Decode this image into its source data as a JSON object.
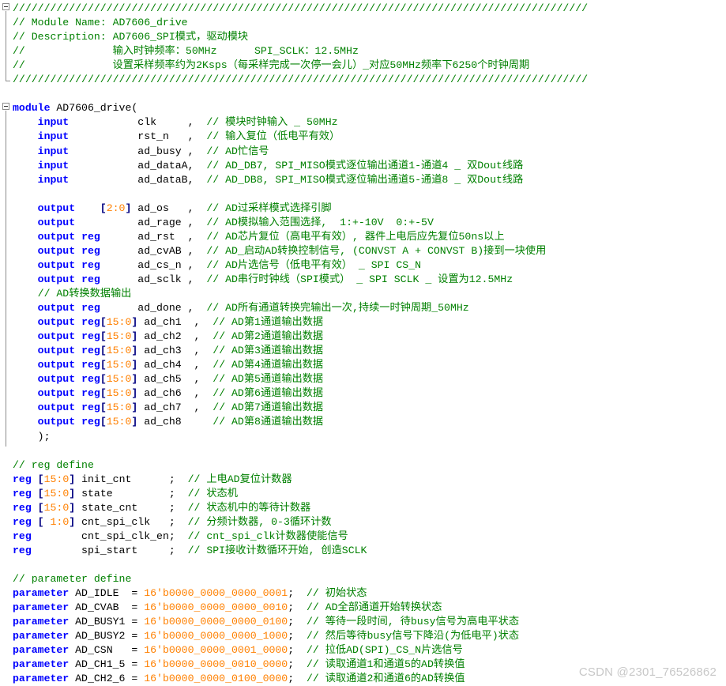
{
  "editor": {
    "language": "verilog",
    "colors": {
      "comment": "#008000",
      "keyword": "#0000ff",
      "number": "#ff8000",
      "operator": "#000080",
      "text": "#000000"
    },
    "lines": [
      [
        [
          "cm",
          "////////////////////////////////////////////////////////////////////////////////////////////"
        ]
      ],
      [
        [
          "cm",
          "// Module Name: AD7606_drive"
        ]
      ],
      [
        [
          "cm",
          "// Description: AD7606_SPI模式，驱动模块"
        ]
      ],
      [
        [
          "cm",
          "//              输入时钟频率：50MHz      SPI_SCLK：12.5MHz"
        ]
      ],
      [
        [
          "cm",
          "//              设置采样频率约为2Ksps（每采样完成一次停一会儿）_对应50MHz频率下6250个时钟周期"
        ]
      ],
      [
        [
          "cm",
          "////////////////////////////////////////////////////////////////////////////////////////////"
        ]
      ],
      [],
      [
        [
          "kw",
          "module"
        ],
        [
          "id",
          " AD7606_drive("
        ]
      ],
      [
        [
          "id",
          "    "
        ],
        [
          "kw",
          "input"
        ],
        [
          "id",
          "           clk     ,  "
        ],
        [
          "cm",
          "// 模块时钟输入 _ 50MHz"
        ]
      ],
      [
        [
          "id",
          "    "
        ],
        [
          "kw",
          "input"
        ],
        [
          "id",
          "           rst_n   ,  "
        ],
        [
          "cm",
          "// 输入复位（低电平有效）"
        ]
      ],
      [
        [
          "id",
          "    "
        ],
        [
          "kw",
          "input"
        ],
        [
          "id",
          "           ad_busy ,  "
        ],
        [
          "cm",
          "// AD忙信号"
        ]
      ],
      [
        [
          "id",
          "    "
        ],
        [
          "kw",
          "input"
        ],
        [
          "id",
          "           ad_dataA,  "
        ],
        [
          "cm",
          "// AD_DB7, SPI_MISO模式逐位输出通道1-通道4 _ 双Dout线路"
        ]
      ],
      [
        [
          "id",
          "    "
        ],
        [
          "kw",
          "input"
        ],
        [
          "id",
          "           ad_dataB,  "
        ],
        [
          "cm",
          "// AD_DB8, SPI_MISO模式逐位输出通道5-通道8 _ 双Dout线路"
        ]
      ],
      [],
      [
        [
          "id",
          "    "
        ],
        [
          "kw",
          "output"
        ],
        [
          "id",
          "    "
        ],
        [
          "op",
          "["
        ],
        [
          "nm",
          "2:0"
        ],
        [
          "op",
          "]"
        ],
        [
          "id",
          " ad_os   ,  "
        ],
        [
          "cm",
          "// AD过采样模式选择引脚"
        ]
      ],
      [
        [
          "id",
          "    "
        ],
        [
          "kw",
          "output"
        ],
        [
          "id",
          "          ad_rage ,  "
        ],
        [
          "cm",
          "// AD模拟输入范围选择,  1:+-10V  0:+-5V"
        ]
      ],
      [
        [
          "id",
          "    "
        ],
        [
          "kw",
          "output"
        ],
        [
          "id",
          " "
        ],
        [
          "kw",
          "reg"
        ],
        [
          "id",
          "      ad_rst  ,  "
        ],
        [
          "cm",
          "// AD芯片复位（高电平有效）, 器件上电后应先复位50ns以上"
        ]
      ],
      [
        [
          "id",
          "    "
        ],
        [
          "kw",
          "output"
        ],
        [
          "id",
          " "
        ],
        [
          "kw",
          "reg"
        ],
        [
          "id",
          "      ad_cvAB ,  "
        ],
        [
          "cm",
          "// AD_启动AD转换控制信号, (CONVST A + CONVST B)接到一块使用"
        ]
      ],
      [
        [
          "id",
          "    "
        ],
        [
          "kw",
          "output"
        ],
        [
          "id",
          " "
        ],
        [
          "kw",
          "reg"
        ],
        [
          "id",
          "      ad_cs_n ,  "
        ],
        [
          "cm",
          "// AD片选信号（低电平有效） _ SPI CS_N"
        ]
      ],
      [
        [
          "id",
          "    "
        ],
        [
          "kw",
          "output"
        ],
        [
          "id",
          " "
        ],
        [
          "kw",
          "reg"
        ],
        [
          "id",
          "      ad_sclk ,  "
        ],
        [
          "cm",
          "// AD串行时钟线（SPI模式） _ SPI SCLK _ 设置为12.5MHz"
        ]
      ],
      [
        [
          "id",
          "    "
        ],
        [
          "cm",
          "// AD转换数据输出"
        ]
      ],
      [
        [
          "id",
          "    "
        ],
        [
          "kw",
          "output"
        ],
        [
          "id",
          " "
        ],
        [
          "kw",
          "reg"
        ],
        [
          "id",
          "      ad_done ,  "
        ],
        [
          "cm",
          "// AD所有通道转换完输出一次,持续一时钟周期_50MHz"
        ]
      ],
      [
        [
          "id",
          "    "
        ],
        [
          "kw",
          "output"
        ],
        [
          "id",
          " "
        ],
        [
          "kw",
          "reg"
        ],
        [
          "op",
          "["
        ],
        [
          "nm",
          "15:0"
        ],
        [
          "op",
          "]"
        ],
        [
          "id",
          " ad_ch1  ,  "
        ],
        [
          "cm",
          "// AD第1通道输出数据"
        ]
      ],
      [
        [
          "id",
          "    "
        ],
        [
          "kw",
          "output"
        ],
        [
          "id",
          " "
        ],
        [
          "kw",
          "reg"
        ],
        [
          "op",
          "["
        ],
        [
          "nm",
          "15:0"
        ],
        [
          "op",
          "]"
        ],
        [
          "id",
          " ad_ch2  ,  "
        ],
        [
          "cm",
          "// AD第2通道输出数据"
        ]
      ],
      [
        [
          "id",
          "    "
        ],
        [
          "kw",
          "output"
        ],
        [
          "id",
          " "
        ],
        [
          "kw",
          "reg"
        ],
        [
          "op",
          "["
        ],
        [
          "nm",
          "15:0"
        ],
        [
          "op",
          "]"
        ],
        [
          "id",
          " ad_ch3  ,  "
        ],
        [
          "cm",
          "// AD第3通道输出数据"
        ]
      ],
      [
        [
          "id",
          "    "
        ],
        [
          "kw",
          "output"
        ],
        [
          "id",
          " "
        ],
        [
          "kw",
          "reg"
        ],
        [
          "op",
          "["
        ],
        [
          "nm",
          "15:0"
        ],
        [
          "op",
          "]"
        ],
        [
          "id",
          " ad_ch4  ,  "
        ],
        [
          "cm",
          "// AD第4通道输出数据"
        ]
      ],
      [
        [
          "id",
          "    "
        ],
        [
          "kw",
          "output"
        ],
        [
          "id",
          " "
        ],
        [
          "kw",
          "reg"
        ],
        [
          "op",
          "["
        ],
        [
          "nm",
          "15:0"
        ],
        [
          "op",
          "]"
        ],
        [
          "id",
          " ad_ch5  ,  "
        ],
        [
          "cm",
          "// AD第5通道输出数据"
        ]
      ],
      [
        [
          "id",
          "    "
        ],
        [
          "kw",
          "output"
        ],
        [
          "id",
          " "
        ],
        [
          "kw",
          "reg"
        ],
        [
          "op",
          "["
        ],
        [
          "nm",
          "15:0"
        ],
        [
          "op",
          "]"
        ],
        [
          "id",
          " ad_ch6  ,  "
        ],
        [
          "cm",
          "// AD第6通道输出数据"
        ]
      ],
      [
        [
          "id",
          "    "
        ],
        [
          "kw",
          "output"
        ],
        [
          "id",
          " "
        ],
        [
          "kw",
          "reg"
        ],
        [
          "op",
          "["
        ],
        [
          "nm",
          "15:0"
        ],
        [
          "op",
          "]"
        ],
        [
          "id",
          " ad_ch7  ,  "
        ],
        [
          "cm",
          "// AD第7通道输出数据"
        ]
      ],
      [
        [
          "id",
          "    "
        ],
        [
          "kw",
          "output"
        ],
        [
          "id",
          " "
        ],
        [
          "kw",
          "reg"
        ],
        [
          "op",
          "["
        ],
        [
          "nm",
          "15:0"
        ],
        [
          "op",
          "]"
        ],
        [
          "id",
          " ad_ch8     "
        ],
        [
          "cm",
          "// AD第8通道输出数据"
        ]
      ],
      [
        [
          "id",
          "    );"
        ]
      ],
      [],
      [
        [
          "cm",
          "// reg define"
        ]
      ],
      [
        [
          "kw",
          "reg"
        ],
        [
          "id",
          " "
        ],
        [
          "op",
          "["
        ],
        [
          "nm",
          "15:0"
        ],
        [
          "op",
          "]"
        ],
        [
          "id",
          " init_cnt      ;  "
        ],
        [
          "cm",
          "// 上电AD复位计数器"
        ]
      ],
      [
        [
          "kw",
          "reg"
        ],
        [
          "id",
          " "
        ],
        [
          "op",
          "["
        ],
        [
          "nm",
          "15:0"
        ],
        [
          "op",
          "]"
        ],
        [
          "id",
          " state         ;  "
        ],
        [
          "cm",
          "// 状态机"
        ]
      ],
      [
        [
          "kw",
          "reg"
        ],
        [
          "id",
          " "
        ],
        [
          "op",
          "["
        ],
        [
          "nm",
          "15:0"
        ],
        [
          "op",
          "]"
        ],
        [
          "id",
          " state_cnt     ;  "
        ],
        [
          "cm",
          "// 状态机中的等待计数器"
        ]
      ],
      [
        [
          "kw",
          "reg"
        ],
        [
          "id",
          " "
        ],
        [
          "op",
          "[ "
        ],
        [
          "nm",
          "1:0"
        ],
        [
          "op",
          "]"
        ],
        [
          "id",
          " cnt_spi_clk   ;  "
        ],
        [
          "cm",
          "// 分频计数器, 0-3循环计数"
        ]
      ],
      [
        [
          "kw",
          "reg"
        ],
        [
          "id",
          "        cnt_spi_clk_en;  "
        ],
        [
          "cm",
          "// cnt_spi_clk计数器使能信号"
        ]
      ],
      [
        [
          "kw",
          "reg"
        ],
        [
          "id",
          "        spi_start     ;  "
        ],
        [
          "cm",
          "// SPI接收计数循环开始, 创造SCLK"
        ]
      ],
      [],
      [
        [
          "cm",
          "// parameter define"
        ]
      ],
      [
        [
          "kw",
          "parameter"
        ],
        [
          "id",
          " AD_IDLE  = "
        ],
        [
          "nm",
          "16'b0000_0000_0000_0001"
        ],
        [
          "id",
          ";  "
        ],
        [
          "cm",
          "// 初始状态"
        ]
      ],
      [
        [
          "kw",
          "parameter"
        ],
        [
          "id",
          " AD_CVAB  = "
        ],
        [
          "nm",
          "16'b0000_0000_0000_0010"
        ],
        [
          "id",
          ";  "
        ],
        [
          "cm",
          "// AD全部通道开始转换状态"
        ]
      ],
      [
        [
          "kw",
          "parameter"
        ],
        [
          "id",
          " AD_BUSY1 = "
        ],
        [
          "nm",
          "16'b0000_0000_0000_0100"
        ],
        [
          "id",
          ";  "
        ],
        [
          "cm",
          "// 等待一段时间, 待busy信号为高电平状态"
        ]
      ],
      [
        [
          "kw",
          "parameter"
        ],
        [
          "id",
          " AD_BUSY2 = "
        ],
        [
          "nm",
          "16'b0000_0000_0000_1000"
        ],
        [
          "id",
          ";  "
        ],
        [
          "cm",
          "// 然后等待busy信号下降沿(为低电平)状态"
        ]
      ],
      [
        [
          "kw",
          "parameter"
        ],
        [
          "id",
          " AD_CSN   = "
        ],
        [
          "nm",
          "16'b0000_0000_0001_0000"
        ],
        [
          "id",
          ";  "
        ],
        [
          "cm",
          "// 拉低AD(SPI)_CS_N片选信号"
        ]
      ],
      [
        [
          "kw",
          "parameter"
        ],
        [
          "id",
          " AD_CH1_5 = "
        ],
        [
          "nm",
          "16'b0000_0000_0010_0000"
        ],
        [
          "id",
          ";  "
        ],
        [
          "cm",
          "// 读取通道1和通道5的AD转换值"
        ]
      ],
      [
        [
          "kw",
          "parameter"
        ],
        [
          "id",
          " AD_CH2_6 = "
        ],
        [
          "nm",
          "16'b0000_0000_0100_0000"
        ],
        [
          "id",
          ";  "
        ],
        [
          "cm",
          "// 读取通道2和通道6的AD转换值"
        ]
      ]
    ]
  },
  "watermark": "CSDN @2301_76526862"
}
